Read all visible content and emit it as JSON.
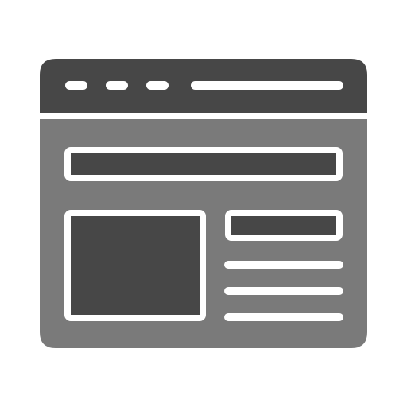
{
  "icon": {
    "name": "web-page-layout-icon",
    "colors": {
      "dark": "#474747",
      "mid": "#7a7a7a",
      "light": "#ffffff"
    }
  }
}
